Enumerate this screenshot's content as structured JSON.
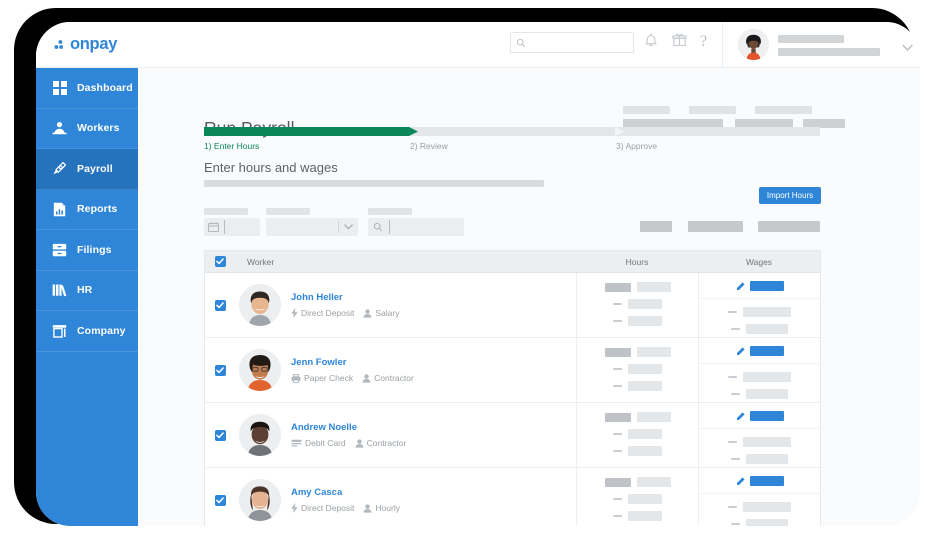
{
  "brand": {
    "logo_text": "onpay",
    "logo_icon": "onpay-dots-logo",
    "primary_color": "#2f86d8",
    "accent_green": "#09865a"
  },
  "topbar": {
    "search": {
      "placeholder": "",
      "value": "",
      "icon": "search-icon"
    },
    "icons": [
      {
        "name": "bell-icon",
        "glyph": "bell"
      },
      {
        "name": "gift-icon",
        "glyph": "gift"
      },
      {
        "name": "help-icon",
        "glyph": "?"
      }
    ],
    "user": {
      "avatar": "user-avatar",
      "chevron": "chevron-down-icon"
    }
  },
  "sidebar": {
    "items": [
      {
        "label": "Dashboard",
        "icon": "grid-icon",
        "active": false
      },
      {
        "label": "Workers",
        "icon": "people-icon",
        "active": false
      },
      {
        "label": "Payroll",
        "icon": "payroll-icon",
        "active": true
      },
      {
        "label": "Reports",
        "icon": "report-icon",
        "active": false
      },
      {
        "label": "Filings",
        "icon": "filings-icon",
        "active": false
      },
      {
        "label": "HR",
        "icon": "books-icon",
        "active": false
      },
      {
        "label": "Company",
        "icon": "store-icon",
        "active": false
      }
    ]
  },
  "main": {
    "page_title": "Run Payroll",
    "section_title": "Enter hours and wages",
    "progress": {
      "percent": 33,
      "steps": [
        {
          "label": "1) Enter Hours",
          "current": true
        },
        {
          "label": "2) Review",
          "current": false
        },
        {
          "label": "3) Approve",
          "current": false
        }
      ]
    },
    "import_hours_label": "Import Hours",
    "filters": [
      {
        "name": "pay-period-date-field",
        "icon": "calendar-icon",
        "value": ""
      },
      {
        "name": "filter-select",
        "icon": "chevron-down-icon",
        "value": ""
      },
      {
        "name": "worker-search-field",
        "icon": "search-icon",
        "value": ""
      }
    ],
    "table": {
      "columns": [
        "Worker",
        "Hours",
        "Wages"
      ],
      "select_all_checked": true,
      "rows": [
        {
          "name": "John Heller",
          "checked": true,
          "payment_method": "Direct Deposit",
          "payment_icon": "lightning-bolt-icon",
          "worker_type": "Salary",
          "type_icon": "person-icon",
          "avatar": "avatar-john-heller"
        },
        {
          "name": "Jenn Fowler",
          "checked": true,
          "payment_method": "Paper Check",
          "payment_icon": "printer-icon",
          "worker_type": "Contractor",
          "type_icon": "person-icon",
          "avatar": "avatar-jenn-fowler"
        },
        {
          "name": "Andrew Noelle",
          "checked": true,
          "payment_method": "Debit Card",
          "payment_icon": "credit-card-icon",
          "worker_type": "Contractor",
          "type_icon": "person-icon",
          "avatar": "avatar-andrew-noelle"
        },
        {
          "name": "Amy Casca",
          "checked": true,
          "payment_method": "Direct Deposit",
          "payment_icon": "lightning-bolt-icon",
          "worker_type": "Hourly",
          "type_icon": "person-icon",
          "avatar": "avatar-amy-casca"
        }
      ]
    }
  }
}
